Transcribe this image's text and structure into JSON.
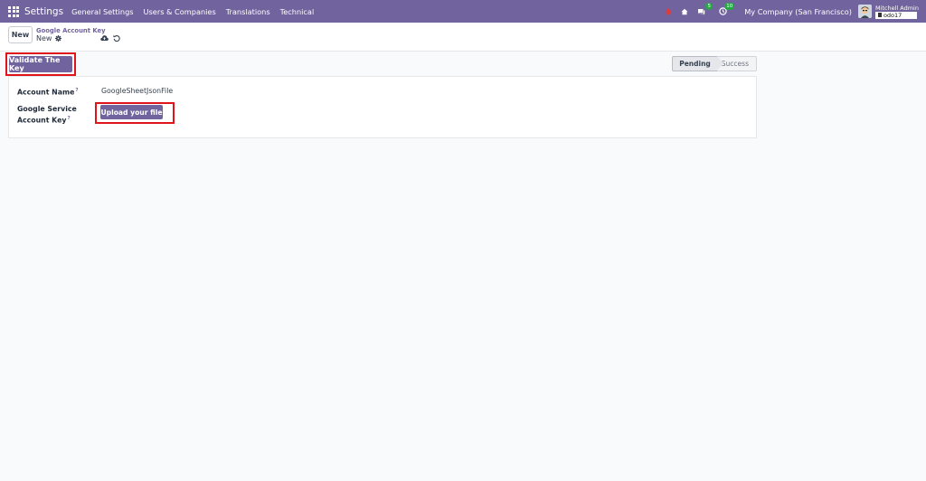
{
  "navbar": {
    "app_name": "Settings",
    "menu": [
      "General Settings",
      "Users & Companies",
      "Translations",
      "Technical"
    ],
    "discuss_badge": "5",
    "activity_badge": "10",
    "company": "My Company (San Francisco)",
    "user_name": "Mitchell Admin",
    "database": "odo17"
  },
  "control_panel": {
    "new_label": "New",
    "breadcrumb": "Google Account Key",
    "record_name": "New"
  },
  "header": {
    "validate_label": "Validate The Key",
    "status": [
      "Pending",
      "Success"
    ],
    "active_status": "Pending"
  },
  "form": {
    "account_name_label": "Account Name",
    "account_name_value": "GoogleSheetJsonFile",
    "service_key_label_line1": "Google Service",
    "service_key_label_line2": "Account Key",
    "help_mark": "?",
    "upload_label": "Upload your file"
  },
  "colors": {
    "brand": "#71639e",
    "highlight": "#e0141b",
    "badge": "#28a745"
  }
}
